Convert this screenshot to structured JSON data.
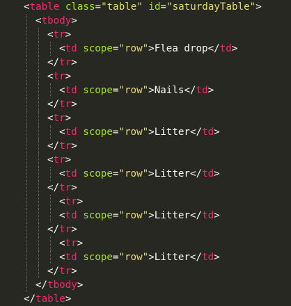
{
  "theme": {
    "background": "#272822",
    "punctuation": "#f8f8f2",
    "tag": "#f92672",
    "attribute": "#a6e22e",
    "string": "#e6db74",
    "text": "#f8f8f2",
    "guide": "#6b6b63"
  },
  "editor": {
    "lines": [
      {
        "indent": 2,
        "tokens": [
          [
            "punct",
            "<"
          ],
          [
            "tag",
            "table"
          ],
          [
            "punct",
            " "
          ],
          [
            "attr",
            "class"
          ],
          [
            "op",
            "="
          ],
          [
            "value",
            "\"table\""
          ],
          [
            "punct",
            " "
          ],
          [
            "attr",
            "id"
          ],
          [
            "op",
            "="
          ],
          [
            "value",
            "\"saturdayTable\""
          ],
          [
            "punct",
            ">"
          ]
        ]
      },
      {
        "indent": 3,
        "tokens": [
          [
            "punct",
            "<"
          ],
          [
            "tag",
            "tbody"
          ],
          [
            "punct",
            ">"
          ]
        ]
      },
      {
        "indent": 4,
        "tokens": [
          [
            "punct",
            "<"
          ],
          [
            "tag",
            "tr"
          ],
          [
            "punct",
            ">"
          ]
        ]
      },
      {
        "indent": 5,
        "tokens": [
          [
            "punct",
            "<"
          ],
          [
            "tag",
            "td"
          ],
          [
            "punct",
            " "
          ],
          [
            "attr",
            "scope"
          ],
          [
            "op",
            "="
          ],
          [
            "value",
            "\"row\""
          ],
          [
            "punct",
            ">"
          ],
          [
            "text",
            "Flea drop"
          ],
          [
            "punct",
            "</"
          ],
          [
            "tag",
            "td"
          ],
          [
            "punct",
            ">"
          ]
        ]
      },
      {
        "indent": 4,
        "tokens": [
          [
            "punct",
            "</"
          ],
          [
            "tag",
            "tr"
          ],
          [
            "punct",
            ">"
          ]
        ]
      },
      {
        "indent": 4,
        "tokens": [
          [
            "punct",
            "<"
          ],
          [
            "tag",
            "tr"
          ],
          [
            "punct",
            ">"
          ]
        ]
      },
      {
        "indent": 5,
        "tokens": [
          [
            "punct",
            "<"
          ],
          [
            "tag",
            "td"
          ],
          [
            "punct",
            " "
          ],
          [
            "attr",
            "scope"
          ],
          [
            "op",
            "="
          ],
          [
            "value",
            "\"row\""
          ],
          [
            "punct",
            ">"
          ],
          [
            "text",
            "Nails"
          ],
          [
            "punct",
            "</"
          ],
          [
            "tag",
            "td"
          ],
          [
            "punct",
            ">"
          ]
        ]
      },
      {
        "indent": 4,
        "tokens": [
          [
            "punct",
            "</"
          ],
          [
            "tag",
            "tr"
          ],
          [
            "punct",
            ">"
          ]
        ]
      },
      {
        "indent": 4,
        "tokens": [
          [
            "punct",
            "<"
          ],
          [
            "tag",
            "tr"
          ],
          [
            "punct",
            ">"
          ]
        ]
      },
      {
        "indent": 5,
        "tokens": [
          [
            "punct",
            "<"
          ],
          [
            "tag",
            "td"
          ],
          [
            "punct",
            " "
          ],
          [
            "attr",
            "scope"
          ],
          [
            "op",
            "="
          ],
          [
            "value",
            "\"row\""
          ],
          [
            "punct",
            ">"
          ],
          [
            "text",
            "Litter"
          ],
          [
            "punct",
            "</"
          ],
          [
            "tag",
            "td"
          ],
          [
            "punct",
            ">"
          ]
        ]
      },
      {
        "indent": 4,
        "tokens": [
          [
            "punct",
            "</"
          ],
          [
            "tag",
            "tr"
          ],
          [
            "punct",
            ">"
          ]
        ]
      },
      {
        "indent": 4,
        "tokens": [
          [
            "punct",
            "<"
          ],
          [
            "tag",
            "tr"
          ],
          [
            "punct",
            ">"
          ]
        ]
      },
      {
        "indent": 5,
        "tokens": [
          [
            "punct",
            "<"
          ],
          [
            "tag",
            "td"
          ],
          [
            "punct",
            " "
          ],
          [
            "attr",
            "scope"
          ],
          [
            "op",
            "="
          ],
          [
            "value",
            "\"row\""
          ],
          [
            "punct",
            ">"
          ],
          [
            "text",
            "Litter"
          ],
          [
            "punct",
            "</"
          ],
          [
            "tag",
            "td"
          ],
          [
            "punct",
            ">"
          ]
        ]
      },
      {
        "indent": 4,
        "tokens": [
          [
            "punct",
            "</"
          ],
          [
            "tag",
            "tr"
          ],
          [
            "punct",
            ">"
          ]
        ]
      },
      {
        "indent": 5,
        "tokens": [
          [
            "punct",
            "<"
          ],
          [
            "tag",
            "tr"
          ],
          [
            "punct",
            ">"
          ]
        ]
      },
      {
        "indent": 5,
        "tokens": [
          [
            "punct",
            "<"
          ],
          [
            "tag",
            "td"
          ],
          [
            "punct",
            " "
          ],
          [
            "attr",
            "scope"
          ],
          [
            "op",
            "="
          ],
          [
            "value",
            "\"row\""
          ],
          [
            "punct",
            ">"
          ],
          [
            "text",
            "Litter"
          ],
          [
            "punct",
            "</"
          ],
          [
            "tag",
            "td"
          ],
          [
            "punct",
            ">"
          ]
        ]
      },
      {
        "indent": 4,
        "tokens": [
          [
            "punct",
            "</"
          ],
          [
            "tag",
            "tr"
          ],
          [
            "punct",
            ">"
          ]
        ]
      },
      {
        "indent": 5,
        "tokens": [
          [
            "punct",
            "<"
          ],
          [
            "tag",
            "tr"
          ],
          [
            "punct",
            ">"
          ]
        ]
      },
      {
        "indent": 5,
        "tokens": [
          [
            "punct",
            "<"
          ],
          [
            "tag",
            "td"
          ],
          [
            "punct",
            " "
          ],
          [
            "attr",
            "scope"
          ],
          [
            "op",
            "="
          ],
          [
            "value",
            "\"row\""
          ],
          [
            "punct",
            ">"
          ],
          [
            "text",
            "Litter"
          ],
          [
            "punct",
            "</"
          ],
          [
            "tag",
            "td"
          ],
          [
            "punct",
            ">"
          ]
        ]
      },
      {
        "indent": 4,
        "tokens": [
          [
            "punct",
            "</"
          ],
          [
            "tag",
            "tr"
          ],
          [
            "punct",
            ">"
          ]
        ]
      },
      {
        "indent": 3,
        "tokens": [
          [
            "punct",
            "</"
          ],
          [
            "tag",
            "tbody"
          ],
          [
            "punct",
            ">"
          ]
        ]
      },
      {
        "indent": 2,
        "tokens": [
          [
            "punct",
            "</"
          ],
          [
            "tag",
            "table"
          ],
          [
            "punct",
            ">"
          ]
        ]
      }
    ]
  }
}
